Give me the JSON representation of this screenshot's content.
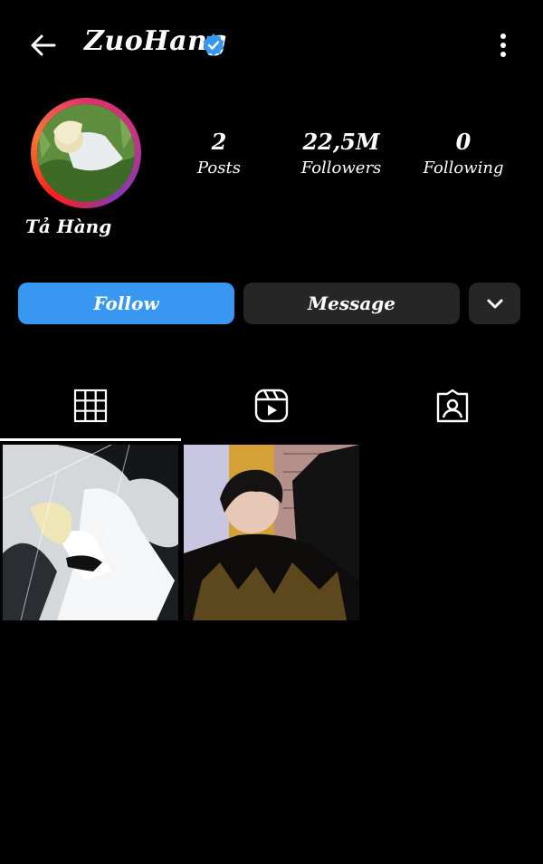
{
  "header": {
    "username": "ZuoHang",
    "back_icon": "back-arrow-icon",
    "verified_icon": "verified-badge-icon",
    "more_icon": "more-vertical-icon"
  },
  "profile": {
    "display_name": "Tả Hàng",
    "stats": [
      {
        "value": "2",
        "label": "Posts"
      },
      {
        "value": "22,5M",
        "label": "Followers"
      },
      {
        "value": "0",
        "label": "Following"
      }
    ]
  },
  "actions": {
    "follow_label": "Follow",
    "message_label": "Message",
    "more_icon": "chevron-down-icon"
  },
  "tabs": [
    {
      "icon": "grid-icon",
      "active": true
    },
    {
      "icon": "reels-icon",
      "active": false
    },
    {
      "icon": "tagged-icon",
      "active": false
    }
  ],
  "colors": {
    "accent": "#3897f0",
    "button_dark": "#262626",
    "verified": "#3897f0"
  }
}
